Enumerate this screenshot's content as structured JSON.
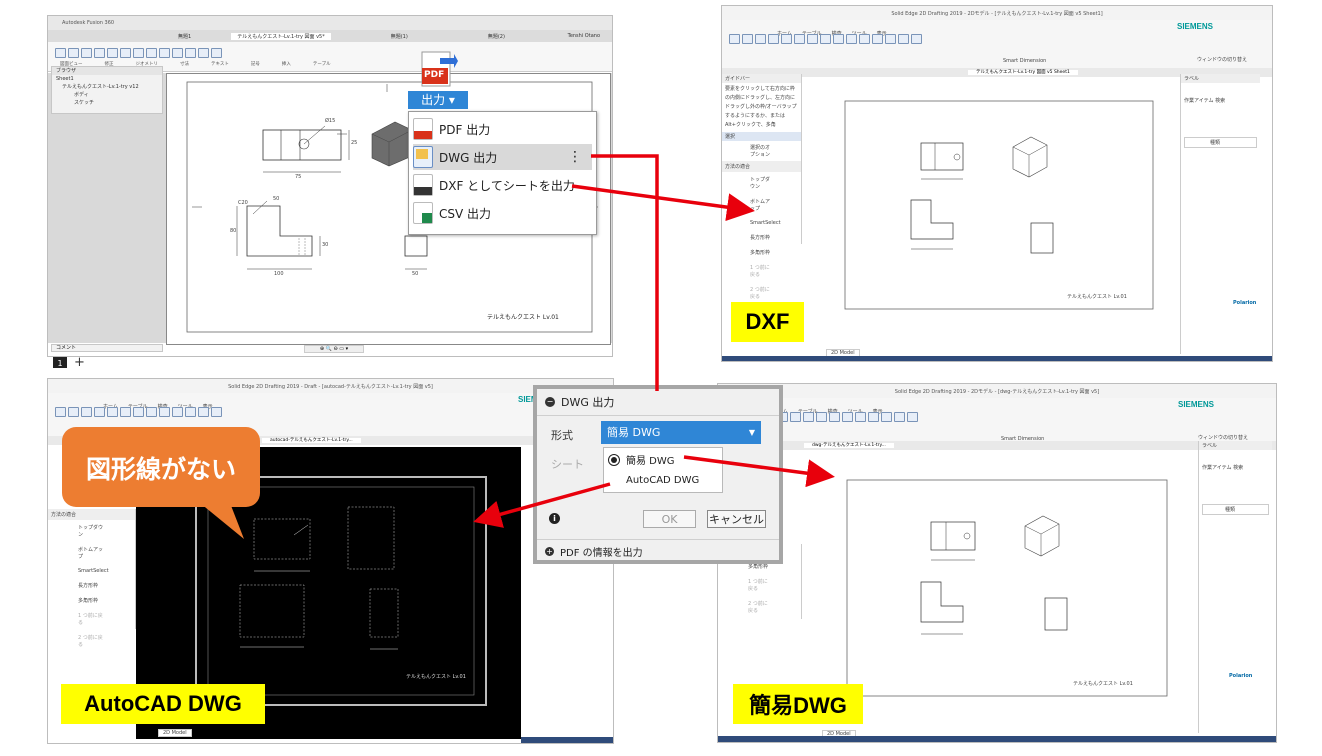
{
  "fusion": {
    "title": "Autodesk Fusion 360",
    "tabs": [
      "無題1",
      "テルえもんクエスト-Lv.1-try 図面 v5*",
      "無題(1)",
      "無題(2)"
    ],
    "user": "Tenshi Otano",
    "browser_title": "ブラウザ",
    "tree": [
      "Sheet1",
      "テルえもんクエスト-Lv.1-try v12",
      "ボディ",
      "スケッチ"
    ],
    "ribbon_groups": [
      "図面ビュー",
      "修正",
      "ジオメトリ",
      "寸法",
      "テキスト",
      "記号",
      "挿入",
      "テーブル"
    ],
    "comment": "コメント",
    "sheet_tab": "1",
    "add": "+",
    "title_block": "テルえもんクエスト Lv.01",
    "dims": {
      "dia": "Ø15",
      "d75": "75",
      "d25": "25",
      "c20": "C20",
      "d50": "50",
      "d80": "80",
      "d30": "30",
      "d100": "100",
      "d50b": "50"
    }
  },
  "output_menu": {
    "button_label": "出力 ▾",
    "pdf_icon_text": "PDF",
    "items": [
      {
        "label": "PDF 出力",
        "icon": "pdf-icon"
      },
      {
        "label": "DWG 出力",
        "icon": "dwg-icon"
      },
      {
        "label": "DXF としてシートを出力",
        "icon": "dxf-icon"
      },
      {
        "label": "CSV 出力",
        "icon": "csv-icon"
      }
    ]
  },
  "solid_edge": {
    "title_dxf": "Solid Edge 2D Drafting 2019 - 2Dモデル - [テルえもんクエスト-Lv.1-try 図面 v5 Sheet1]",
    "title_acad": "Solid Edge 2D Drafting 2019 - Draft - [autocad-テルえもんクエスト-Lv.1-try 図面 v5]",
    "title_simple": "Solid Edge 2D Drafting 2019 - 2Dモデル - [dwg-テルえもんクエスト-Lv.1-try 図面 v5]",
    "brand": "SIEMENS",
    "ribbon_tabs": [
      "ホーム",
      "テーブル",
      "検査",
      "ツール",
      "表示"
    ],
    "smart_dimension": "Smart Dimension",
    "doc_tab_dxf": "テルえもんクエスト-Lv.1-try 図面 v5 Sheet1",
    "doc_tab_acad": "autocad-テルえもんクエスト-Lv.1-try...",
    "doc_tab_simple": "dwg-テルえもんクエスト-Lv.1-try...",
    "left_panel": {
      "title": "ガイドバー",
      "help": "要素をクリックして右方向に枠の内側にドラッグし、左方向にドラッグし外の枠/オーバラップするようにするか、またはAlt+クリックで、多角",
      "select": "選択",
      "options": "選択のオプション",
      "section": "方法の適合",
      "items": [
        "トップダウン",
        "ボトムアップ",
        "SmartSelect",
        "長方形枠",
        "多角形枠",
        "1 つ前に戻る",
        "2 つ前に戻る"
      ]
    },
    "right_panel": {
      "title": "ラベル",
      "tabs": [
        "作業アイテム",
        "検索"
      ],
      "col": "種類",
      "brand": "Polarion"
    },
    "status_tabs": [
      "2D Model",
      "Sheet1"
    ],
    "title_block": "テルえもんクエスト Lv.01",
    "wall_label": "ウィンドウの切り替え"
  },
  "dwg_dialog": {
    "title": "DWG 出力",
    "format_label": "形式",
    "format_value": "簡易 DWG",
    "sheet_label": "シート",
    "options": [
      "簡易 DWG",
      "AutoCAD DWG"
    ],
    "ok": "OK",
    "cancel": "キャンセル",
    "pdf_info": "PDF の情報を出力"
  },
  "callout": {
    "text": "図形線がない"
  },
  "labels": {
    "dxf": "DXF",
    "acad": "AutoCAD DWG",
    "simple": "簡易DWG"
  },
  "colors": {
    "red": "#e8000c",
    "blue": "#2f6fd6",
    "orange": "#ed7d31",
    "yellow": "#ffff00",
    "siemens": "#009999"
  }
}
